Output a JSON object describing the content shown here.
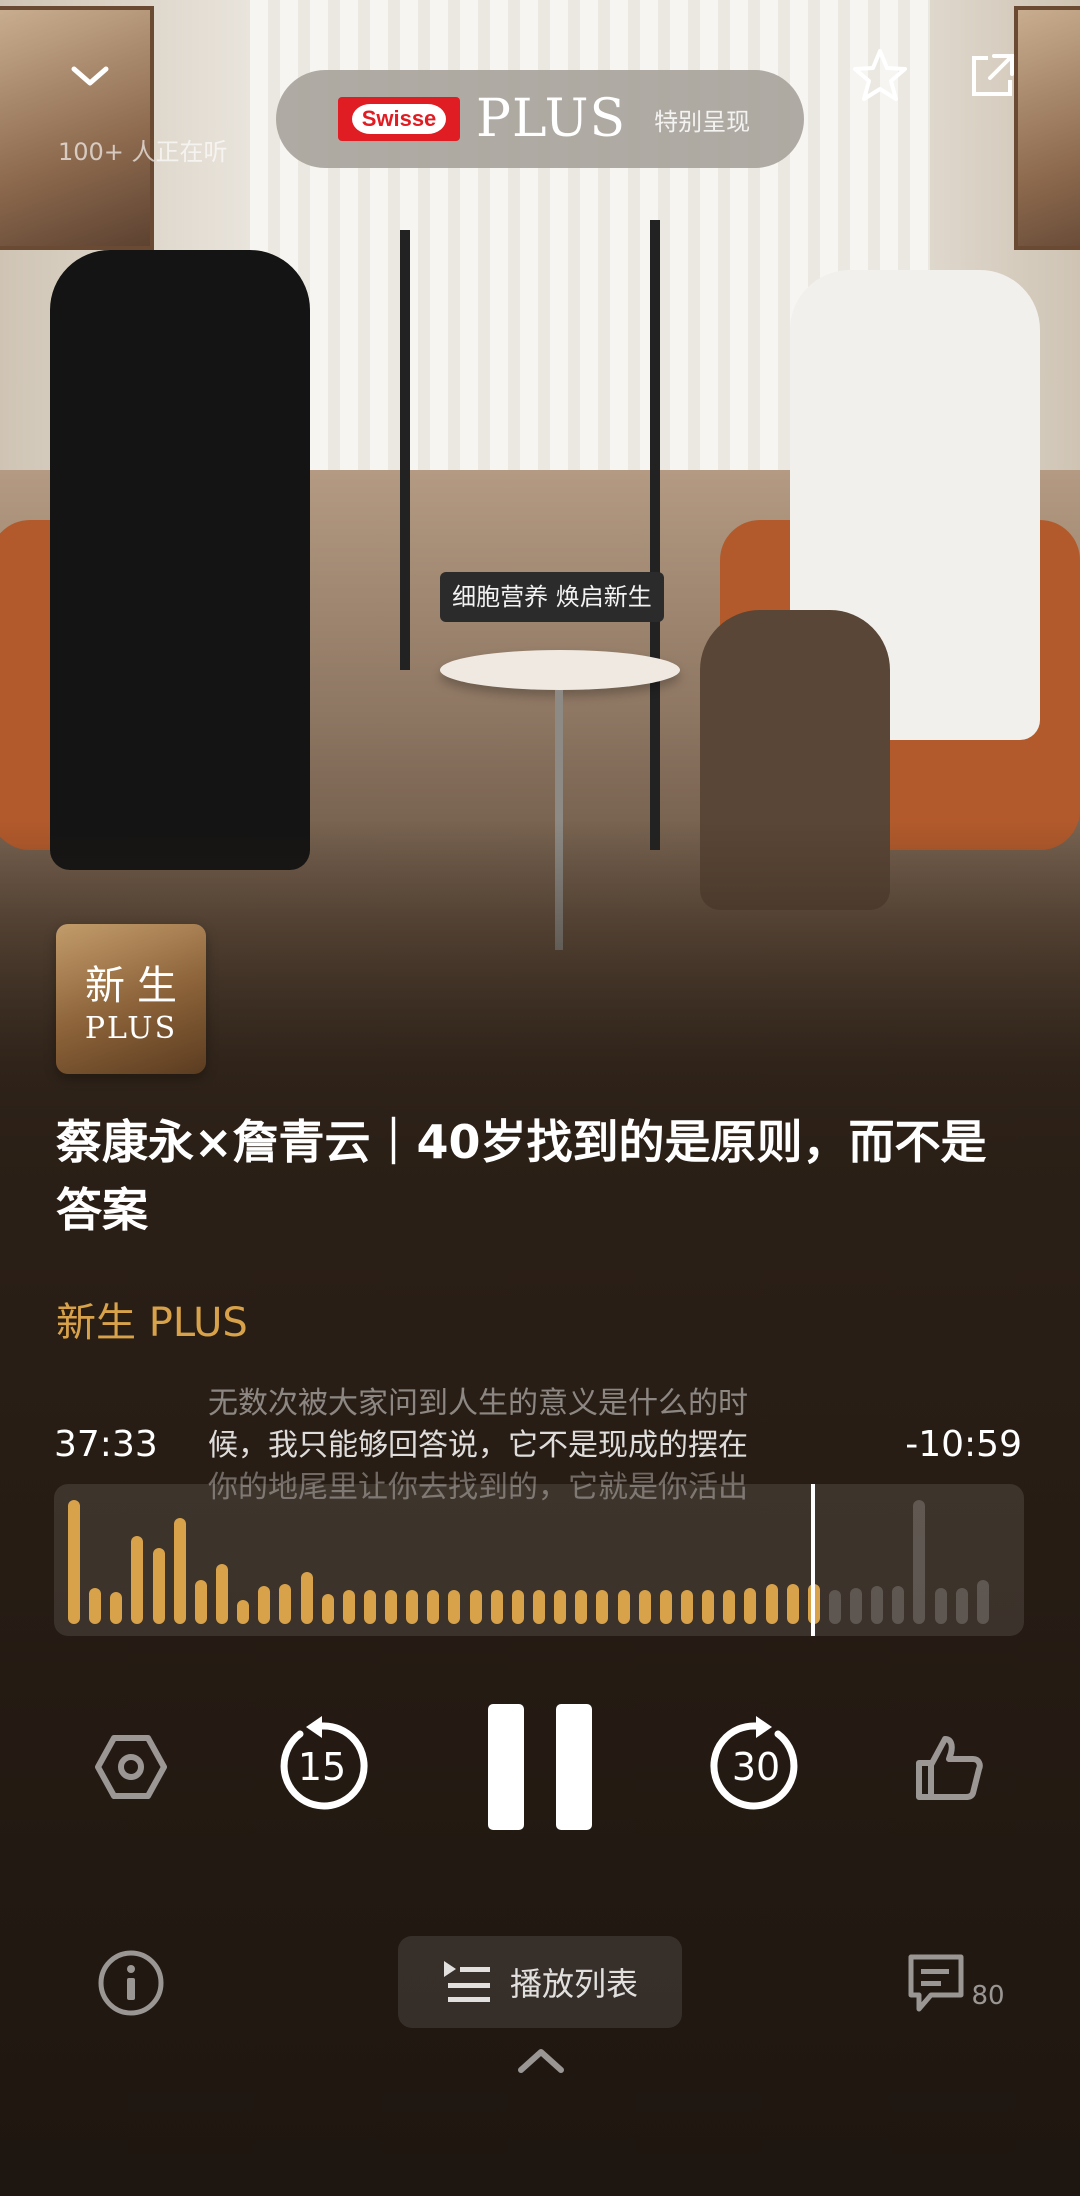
{
  "header": {
    "listeners": "100+ 人正在听",
    "sponsor_brand": "Swisse",
    "sponsor_plus": "PLUS",
    "sponsor_note": "特别呈现"
  },
  "scene": {
    "sign": "细胞营养 焕启新生"
  },
  "cover": {
    "line1": "新生",
    "line2": "PLUS"
  },
  "episode": {
    "title": "蔡康永×詹青云｜40岁找到的是原则，而不是答案",
    "channel": "新生 PLUS"
  },
  "lyrics": [
    "无数次被大家问到人生的意义是什么的时",
    "候，我只能够回答说，它不是现成的摆在",
    "你的地尾里让你去找到的，它就是你活出"
  ],
  "player": {
    "elapsed": "37:33",
    "remaining": "-10:59",
    "progress": 0.78,
    "rewind_seconds": "15",
    "forward_seconds": "30",
    "comment_count": "80",
    "playlist_label": "播放列表"
  },
  "colors": {
    "accent": "#d8a24a",
    "background": "#2a1f16"
  }
}
